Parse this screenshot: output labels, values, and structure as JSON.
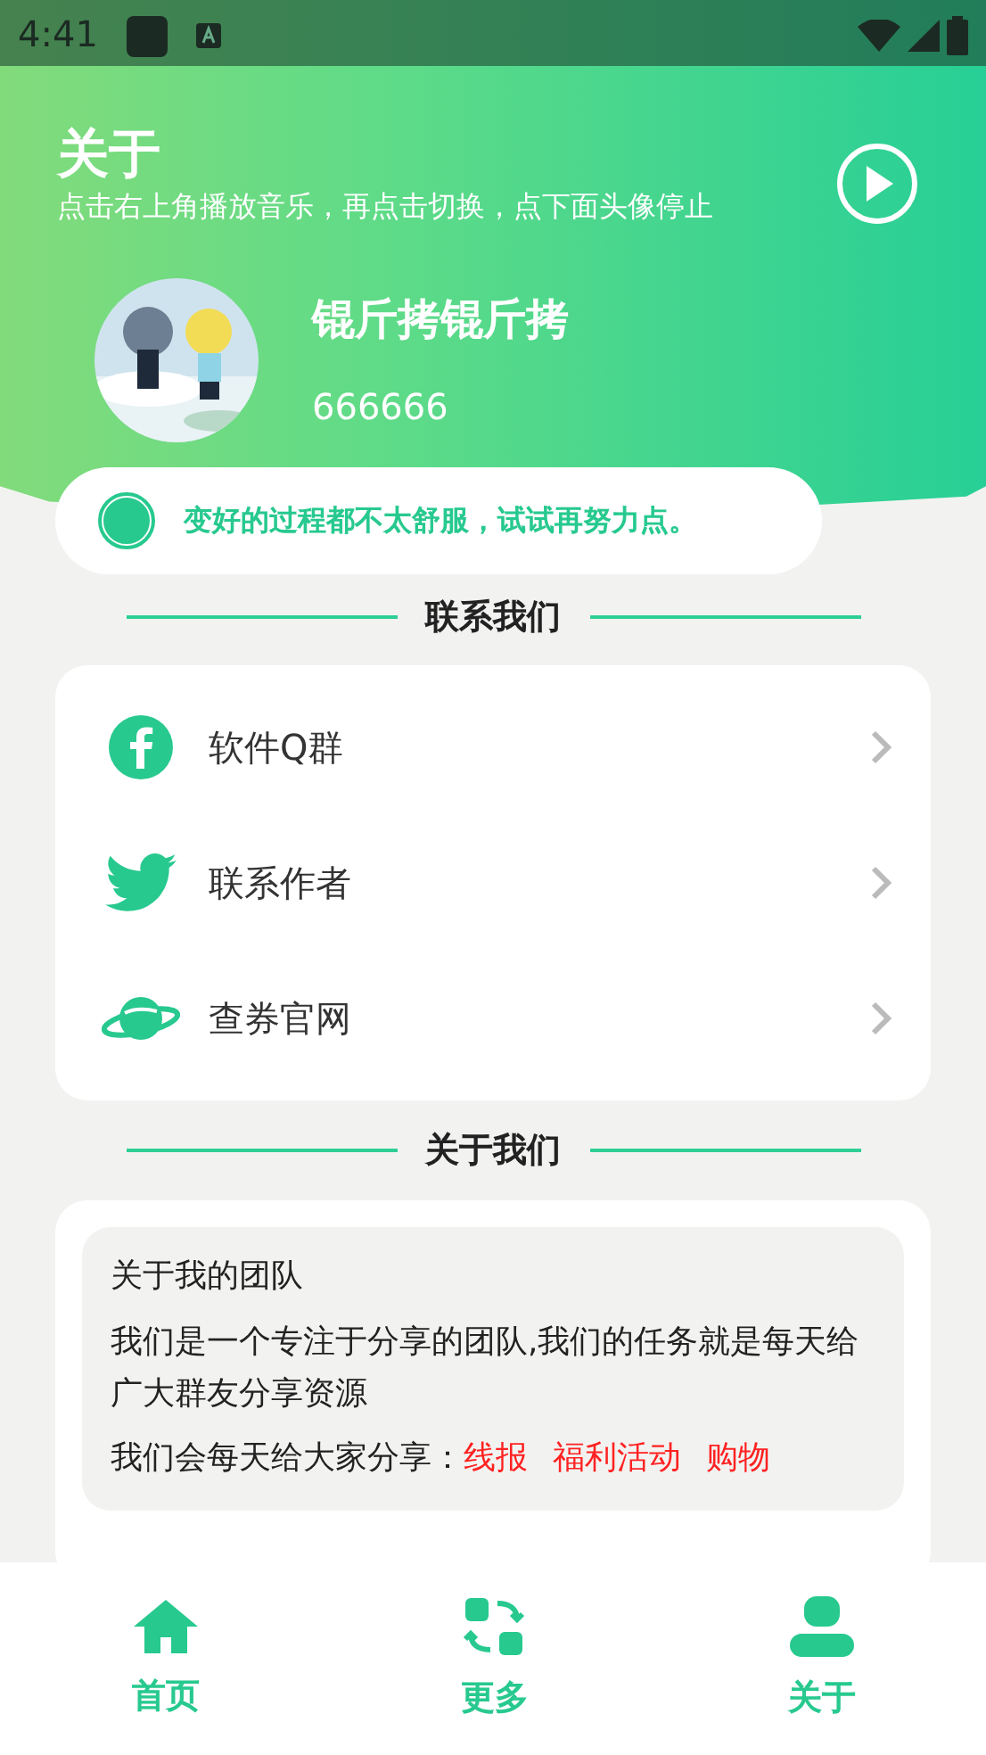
{
  "status_bar": {
    "time": "4:41"
  },
  "header": {
    "title": "关于",
    "subtitle": "点击右上角播放音乐，再点击切换，点下面头像停止",
    "profile": {
      "name": "锟斤拷锟斤拷",
      "id": "666666"
    }
  },
  "motto": "变好的过程都不太舒服，试试再努力点。",
  "contact": {
    "title": "联系我们",
    "items": [
      {
        "kind": "facebook",
        "label": "软件Q群"
      },
      {
        "kind": "twitter",
        "label": "联系作者"
      },
      {
        "kind": "planet",
        "label": "查券官网"
      }
    ]
  },
  "about": {
    "title": "关于我们",
    "paragraphs": [
      "关于我的团队",
      "我们是一个专注于分享的团队,我们的任务就是每天给广大群友分享资源"
    ],
    "partial_line": {
      "text": "我们会每天给大家分享：",
      "tags": [
        "线报",
        "福利活动",
        "购物"
      ]
    }
  },
  "bottom_nav": [
    {
      "kind": "home",
      "label": "首页"
    },
    {
      "kind": "switch",
      "label": "更多"
    },
    {
      "kind": "person",
      "label": "关于"
    }
  ]
}
